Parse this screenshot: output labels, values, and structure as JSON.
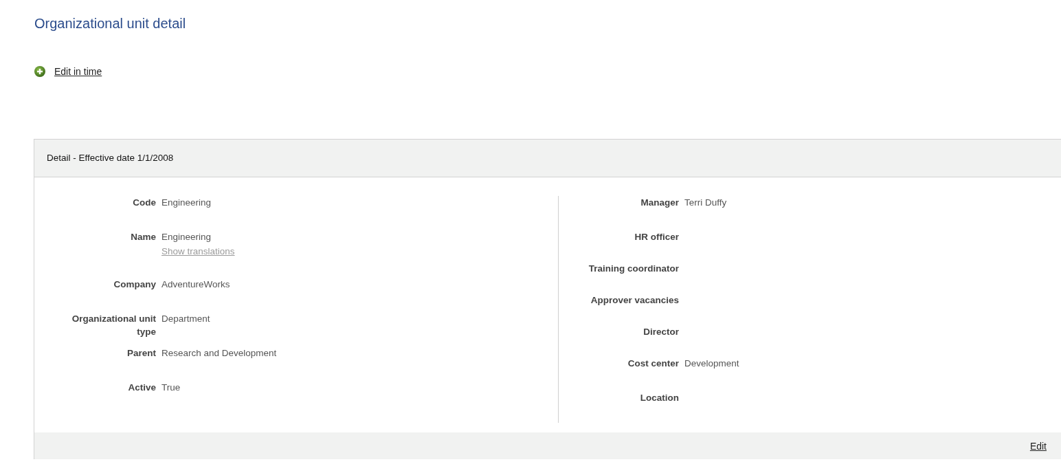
{
  "page": {
    "title": "Organizational unit detail"
  },
  "actions": [
    {
      "label": "Edit in time"
    }
  ],
  "panel": {
    "title": "Detail - Effective date 1/1/2008",
    "columns": [
      {
        "fields": [
          {
            "label": "Code",
            "value": "Engineering"
          },
          {
            "label": "Name",
            "value": "Engineering",
            "link": "Show translations"
          },
          {
            "label": "Company",
            "value": "AdventureWorks"
          },
          {
            "label": "Organizational unit type",
            "value": "Department"
          },
          {
            "label": "Parent",
            "value": "Research and Development"
          },
          {
            "label": "Active",
            "value": "True"
          }
        ]
      },
      {
        "fields": [
          {
            "label": "Manager",
            "value": "Terri Duffy"
          },
          {
            "label": "HR officer"
          },
          {
            "label": "Training coordinator"
          },
          {
            "label": "Approver vacancies"
          },
          {
            "label": "Director"
          },
          {
            "label": "Cost center",
            "value": "Development"
          },
          {
            "label": "Location"
          }
        ]
      }
    ],
    "footer": {
      "link": "Edit"
    }
  }
}
